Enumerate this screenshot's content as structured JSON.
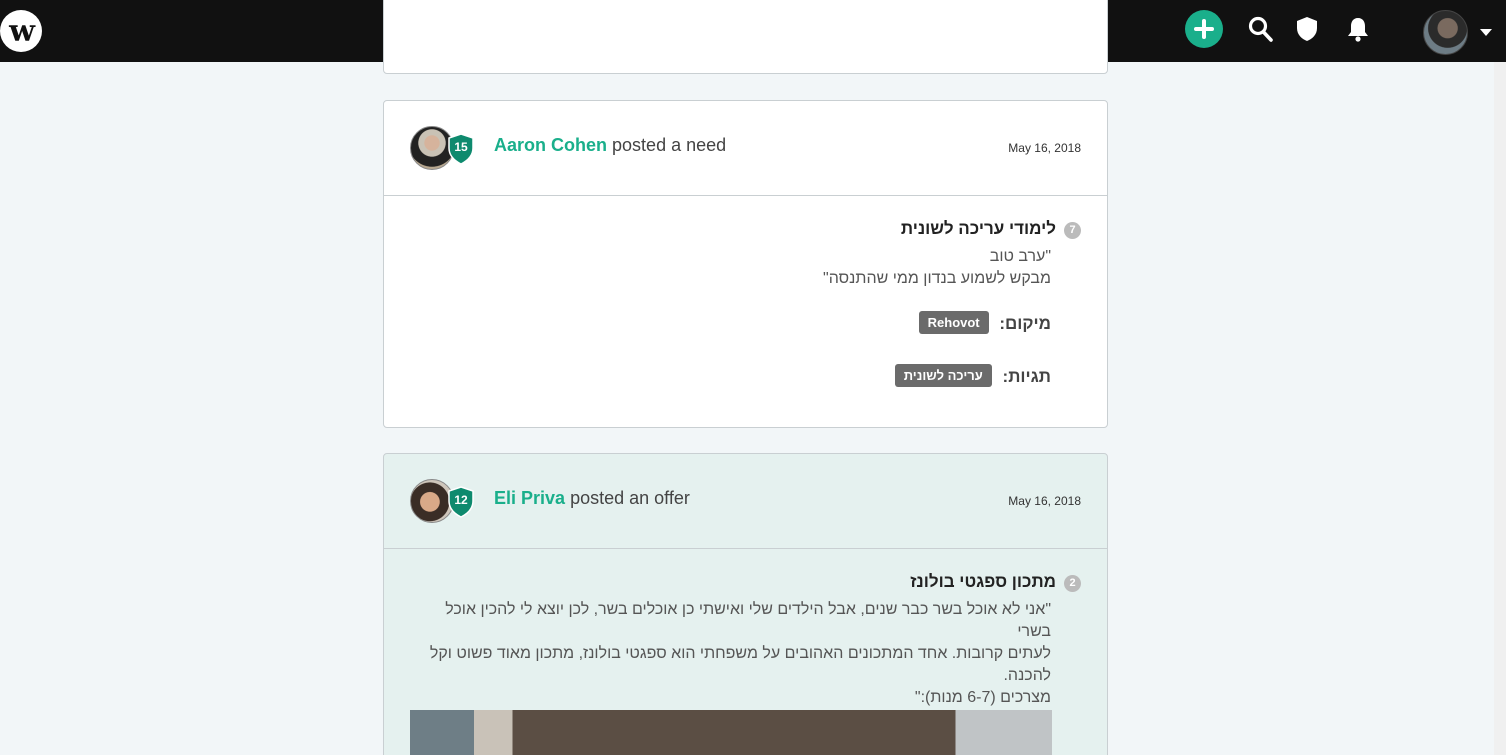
{
  "topbar": {
    "logo_text": "w",
    "icons": [
      "add-post-icon",
      "search-icon",
      "shield-icon",
      "bell-icon",
      "user-avatar",
      "caret-down-icon"
    ]
  },
  "posts": [
    {
      "author": "Aaron Cohen",
      "action": "posted a need",
      "level": "15",
      "date": "May 16, 2018",
      "title": "לימודי עריכה לשונית",
      "count": "7",
      "body_lines": [
        "\"ערב טוב",
        "מבקש לשמוע בנדון ממי שהתנסה\""
      ],
      "location_label": "מיקום:",
      "location": "Rehovot",
      "tags_label": "תגיות:",
      "tag": "עריכה לשונית"
    },
    {
      "author": "Eli Priva",
      "action": "posted an offer",
      "level": "12",
      "date": "May 16, 2018",
      "title": "מתכון ספגטי בולונז",
      "count": "2",
      "body_lines": [
        "\"אני לא אוכל בשר כבר שנים, אבל הילדים שלי ואישתי כן אוכלים בשר, לכן יוצא לי להכין אוכל בשרי",
        "לעתים קרובות. אחד המתכונים האהובים על משפחתי הוא ספגטי בולונז, מתכון מאוד פשוט וקל",
        "להכנה.",
        "מצרכים (6-7 מנות):\""
      ]
    }
  ],
  "colors": {
    "accent": "#1aaf8b",
    "badge": "#0e8a6e",
    "topbar": "#111111",
    "offer_bg": "#e5f1ef"
  }
}
